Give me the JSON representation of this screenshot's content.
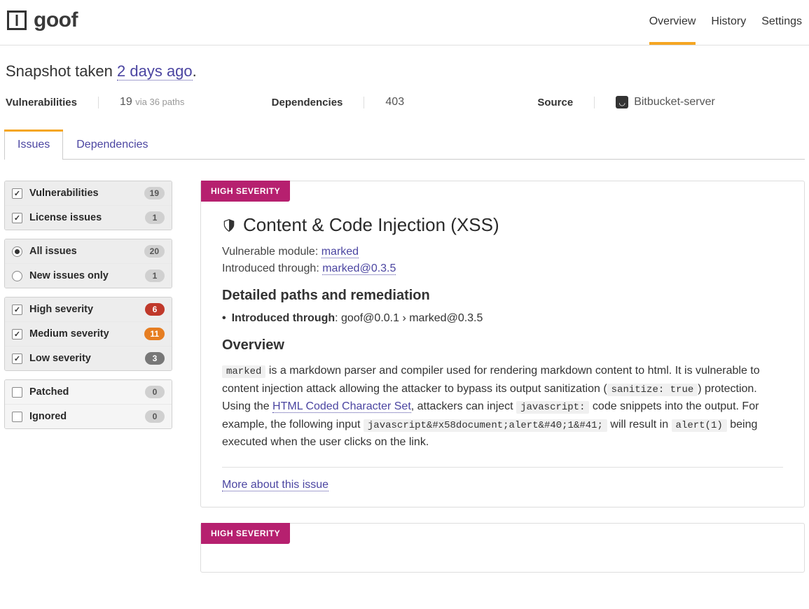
{
  "header": {
    "app_name": "goof",
    "nav": [
      {
        "label": "Overview",
        "active": true
      },
      {
        "label": "History",
        "active": false
      },
      {
        "label": "Settings",
        "active": false
      }
    ]
  },
  "snapshot": {
    "prefix": "Snapshot taken ",
    "link": "2 days ago",
    "suffix": "."
  },
  "stats": {
    "vulnerabilities": {
      "label": "Vulnerabilities",
      "count": "19",
      "via": "via 36 paths"
    },
    "dependencies": {
      "label": "Dependencies",
      "count": "403"
    },
    "source": {
      "label": "Source",
      "value": "Bitbucket-server"
    }
  },
  "tabs": [
    {
      "label": "Issues",
      "active": true
    },
    {
      "label": "Dependencies",
      "active": false
    }
  ],
  "filters": {
    "group1": [
      {
        "label": "Vulnerabilities",
        "checked": true,
        "count": "19",
        "badge_class": ""
      },
      {
        "label": "License issues",
        "checked": true,
        "count": "1",
        "badge_class": ""
      }
    ],
    "group2": [
      {
        "label": "All issues",
        "checked": true,
        "count": "20",
        "type": "radio"
      },
      {
        "label": "New issues only",
        "checked": false,
        "count": "1",
        "type": "radio"
      }
    ],
    "group3": [
      {
        "label": "High severity",
        "checked": true,
        "count": "6",
        "badge_class": "red"
      },
      {
        "label": "Medium severity",
        "checked": true,
        "count": "11",
        "badge_class": "orange"
      },
      {
        "label": "Low severity",
        "checked": true,
        "count": "3",
        "badge_class": "gray-dark"
      }
    ],
    "group4": [
      {
        "label": "Patched",
        "checked": false,
        "count": "0"
      },
      {
        "label": "Ignored",
        "checked": false,
        "count": "0"
      }
    ]
  },
  "issue": {
    "severity": "HIGH SEVERITY",
    "title": "Content & Code Injection (XSS)",
    "vuln_module_label": "Vulnerable module: ",
    "vuln_module": "marked",
    "introduced_label": "Introduced through: ",
    "introduced": "marked@0.3.5",
    "paths_heading": "Detailed paths and remediation",
    "path_intro_label": "Introduced through",
    "path_value": ": goof@0.0.1 › marked@0.3.5",
    "overview_heading": "Overview",
    "ov_code1": "marked",
    "ov_text1": " is a markdown parser and compiler used for rendering markdown content to html. It is vulnerable to content injection attack allowing the attacker to bypass its output sanitization (",
    "ov_code2": "sanitize: true",
    "ov_text2": ") protection. Using the ",
    "ov_link": "HTML Coded Character Set",
    "ov_text3": ", attackers can inject ",
    "ov_code3": "javascript:",
    "ov_text4": " code snippets into the output. For example, the following input ",
    "ov_code4": "javascript&#x58document;alert&#40;1&#41;",
    "ov_text5": " will result in ",
    "ov_code5": "alert(1)",
    "ov_text6": " being executed when the user clicks on the link.",
    "more": "More about this issue"
  },
  "issue2": {
    "severity": "HIGH SEVERITY"
  }
}
